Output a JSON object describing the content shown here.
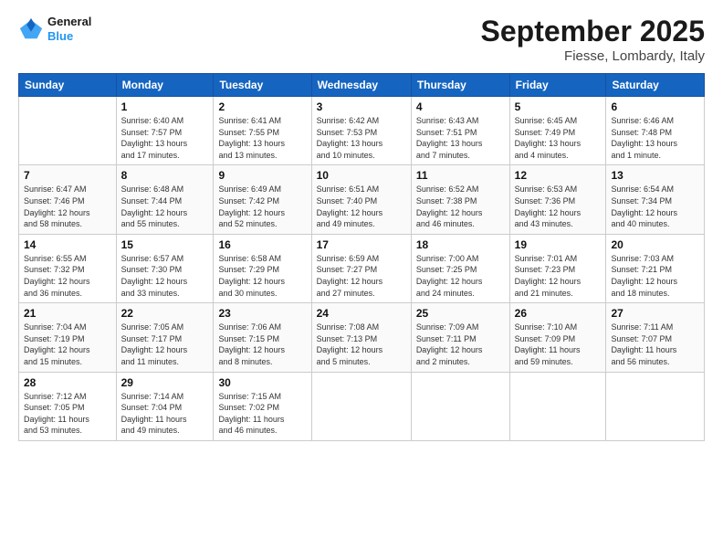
{
  "logo": {
    "line1": "General",
    "line2": "Blue"
  },
  "title": "September 2025",
  "subtitle": "Fiesse, Lombardy, Italy",
  "weekdays": [
    "Sunday",
    "Monday",
    "Tuesday",
    "Wednesday",
    "Thursday",
    "Friday",
    "Saturday"
  ],
  "weeks": [
    [
      {
        "day": "",
        "info": ""
      },
      {
        "day": "1",
        "info": "Sunrise: 6:40 AM\nSunset: 7:57 PM\nDaylight: 13 hours\nand 17 minutes."
      },
      {
        "day": "2",
        "info": "Sunrise: 6:41 AM\nSunset: 7:55 PM\nDaylight: 13 hours\nand 13 minutes."
      },
      {
        "day": "3",
        "info": "Sunrise: 6:42 AM\nSunset: 7:53 PM\nDaylight: 13 hours\nand 10 minutes."
      },
      {
        "day": "4",
        "info": "Sunrise: 6:43 AM\nSunset: 7:51 PM\nDaylight: 13 hours\nand 7 minutes."
      },
      {
        "day": "5",
        "info": "Sunrise: 6:45 AM\nSunset: 7:49 PM\nDaylight: 13 hours\nand 4 minutes."
      },
      {
        "day": "6",
        "info": "Sunrise: 6:46 AM\nSunset: 7:48 PM\nDaylight: 13 hours\nand 1 minute."
      }
    ],
    [
      {
        "day": "7",
        "info": "Sunrise: 6:47 AM\nSunset: 7:46 PM\nDaylight: 12 hours\nand 58 minutes."
      },
      {
        "day": "8",
        "info": "Sunrise: 6:48 AM\nSunset: 7:44 PM\nDaylight: 12 hours\nand 55 minutes."
      },
      {
        "day": "9",
        "info": "Sunrise: 6:49 AM\nSunset: 7:42 PM\nDaylight: 12 hours\nand 52 minutes."
      },
      {
        "day": "10",
        "info": "Sunrise: 6:51 AM\nSunset: 7:40 PM\nDaylight: 12 hours\nand 49 minutes."
      },
      {
        "day": "11",
        "info": "Sunrise: 6:52 AM\nSunset: 7:38 PM\nDaylight: 12 hours\nand 46 minutes."
      },
      {
        "day": "12",
        "info": "Sunrise: 6:53 AM\nSunset: 7:36 PM\nDaylight: 12 hours\nand 43 minutes."
      },
      {
        "day": "13",
        "info": "Sunrise: 6:54 AM\nSunset: 7:34 PM\nDaylight: 12 hours\nand 40 minutes."
      }
    ],
    [
      {
        "day": "14",
        "info": "Sunrise: 6:55 AM\nSunset: 7:32 PM\nDaylight: 12 hours\nand 36 minutes."
      },
      {
        "day": "15",
        "info": "Sunrise: 6:57 AM\nSunset: 7:30 PM\nDaylight: 12 hours\nand 33 minutes."
      },
      {
        "day": "16",
        "info": "Sunrise: 6:58 AM\nSunset: 7:29 PM\nDaylight: 12 hours\nand 30 minutes."
      },
      {
        "day": "17",
        "info": "Sunrise: 6:59 AM\nSunset: 7:27 PM\nDaylight: 12 hours\nand 27 minutes."
      },
      {
        "day": "18",
        "info": "Sunrise: 7:00 AM\nSunset: 7:25 PM\nDaylight: 12 hours\nand 24 minutes."
      },
      {
        "day": "19",
        "info": "Sunrise: 7:01 AM\nSunset: 7:23 PM\nDaylight: 12 hours\nand 21 minutes."
      },
      {
        "day": "20",
        "info": "Sunrise: 7:03 AM\nSunset: 7:21 PM\nDaylight: 12 hours\nand 18 minutes."
      }
    ],
    [
      {
        "day": "21",
        "info": "Sunrise: 7:04 AM\nSunset: 7:19 PM\nDaylight: 12 hours\nand 15 minutes."
      },
      {
        "day": "22",
        "info": "Sunrise: 7:05 AM\nSunset: 7:17 PM\nDaylight: 12 hours\nand 11 minutes."
      },
      {
        "day": "23",
        "info": "Sunrise: 7:06 AM\nSunset: 7:15 PM\nDaylight: 12 hours\nand 8 minutes."
      },
      {
        "day": "24",
        "info": "Sunrise: 7:08 AM\nSunset: 7:13 PM\nDaylight: 12 hours\nand 5 minutes."
      },
      {
        "day": "25",
        "info": "Sunrise: 7:09 AM\nSunset: 7:11 PM\nDaylight: 12 hours\nand 2 minutes."
      },
      {
        "day": "26",
        "info": "Sunrise: 7:10 AM\nSunset: 7:09 PM\nDaylight: 11 hours\nand 59 minutes."
      },
      {
        "day": "27",
        "info": "Sunrise: 7:11 AM\nSunset: 7:07 PM\nDaylight: 11 hours\nand 56 minutes."
      }
    ],
    [
      {
        "day": "28",
        "info": "Sunrise: 7:12 AM\nSunset: 7:05 PM\nDaylight: 11 hours\nand 53 minutes."
      },
      {
        "day": "29",
        "info": "Sunrise: 7:14 AM\nSunset: 7:04 PM\nDaylight: 11 hours\nand 49 minutes."
      },
      {
        "day": "30",
        "info": "Sunrise: 7:15 AM\nSunset: 7:02 PM\nDaylight: 11 hours\nand 46 minutes."
      },
      {
        "day": "",
        "info": ""
      },
      {
        "day": "",
        "info": ""
      },
      {
        "day": "",
        "info": ""
      },
      {
        "day": "",
        "info": ""
      }
    ]
  ]
}
